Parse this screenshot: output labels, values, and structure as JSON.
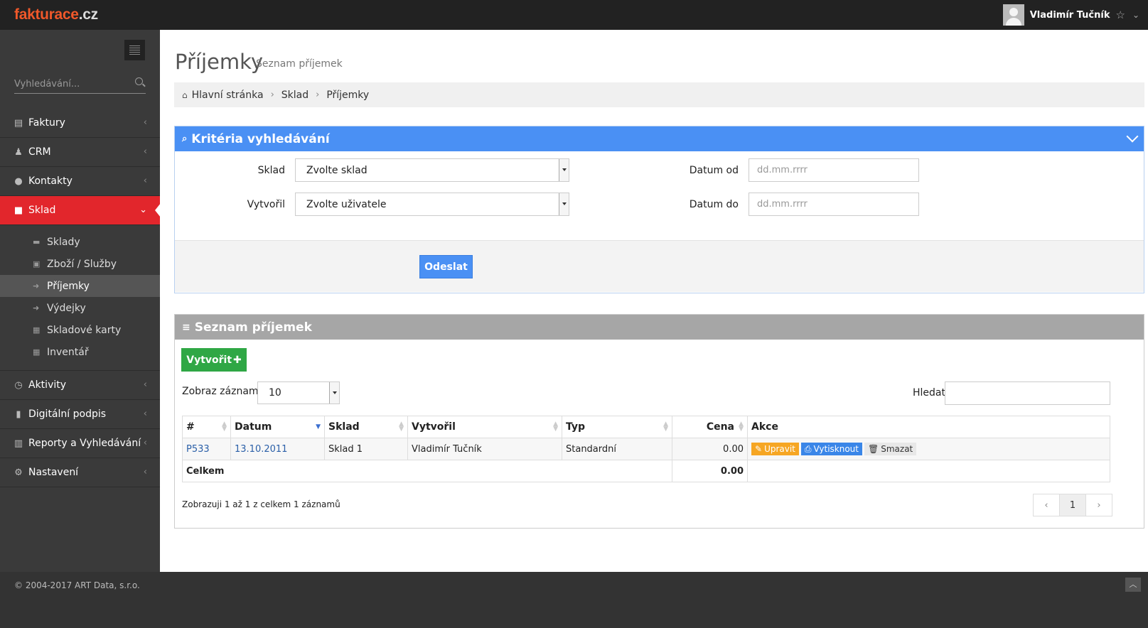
{
  "brand": {
    "name": "fakturace",
    "tld": ".cz"
  },
  "user": {
    "name": "Vladimír Tučník"
  },
  "sidebar": {
    "search_placeholder": "Vyhledávání...",
    "items": [
      {
        "label": "Faktury",
        "icon": "book-icon"
      },
      {
        "label": "CRM",
        "icon": "person-icon"
      },
      {
        "label": "Kontakty",
        "icon": "user-icon"
      },
      {
        "label": "Sklad",
        "icon": "briefcase-icon"
      },
      {
        "label": "Aktivity",
        "icon": "clock-icon"
      },
      {
        "label": "Digitální podpis",
        "icon": "lock-icon"
      },
      {
        "label": "Reporty a Vyhledávání",
        "icon": "bar-chart-icon"
      },
      {
        "label": "Nastavení",
        "icon": "gears-icon"
      }
    ],
    "subitems": [
      {
        "label": "Sklady",
        "icon": "truck-icon"
      },
      {
        "label": "Zboží / Služby",
        "icon": "gift-icon"
      },
      {
        "label": "Příjemky",
        "icon": "sign-in-icon"
      },
      {
        "label": "Výdejky",
        "icon": "sign-out-icon"
      },
      {
        "label": "Skladové karty",
        "icon": "table-icon"
      },
      {
        "label": "Inventář",
        "icon": "table-icon"
      }
    ]
  },
  "page": {
    "title": "Příjemky",
    "subtitle": "Seznam příjemek"
  },
  "breadcrumb": [
    "Hlavní stránka",
    "Sklad",
    "Příjemky"
  ],
  "search_panel": {
    "title": "Kritéria vyhledávání",
    "warehouse_label": "Sklad",
    "warehouse_value": "Zvolte sklad",
    "creator_label": "Vytvořil",
    "creator_value": "Zvolte uživatele",
    "date_from_label": "Datum od",
    "date_from_placeholder": "dd.mm.rrrr",
    "date_to_label": "Datum do",
    "date_to_placeholder": "dd.mm.rrrr",
    "submit_label": "Odeslat"
  },
  "list_panel": {
    "title": "Seznam příjemek",
    "create_label": "Vytvořit",
    "show_label": "Zobraz záznamů",
    "show_value": "10",
    "find_label": "Hledat:",
    "columns": [
      "#",
      "Datum",
      "Sklad",
      "Vytvořil",
      "Typ",
      "Cena",
      "Akce"
    ],
    "rows": [
      {
        "id": "P533",
        "date": "13.10.2011",
        "warehouse": "Sklad 1",
        "creator": "Vladimír Tučník",
        "type": "Standardní",
        "price": "0.00"
      }
    ],
    "actions": {
      "edit": "Upravit",
      "print": "Vytisknout",
      "delete": "Smazat"
    },
    "total_label": "Celkem",
    "total_value": "0.00",
    "info": "Zobrazuji 1 až 1 z celkem 1 záznamů",
    "pager": {
      "prev": "‹",
      "page": "1",
      "next": "›"
    }
  },
  "footer": {
    "copyright": "© 2004-2017 ART Data, s.r.o."
  },
  "colors": {
    "brand": "#f0582a",
    "active": "#e2262c",
    "primary": "#4a90f4",
    "success": "#2fa745",
    "warning": "#f6a623"
  }
}
